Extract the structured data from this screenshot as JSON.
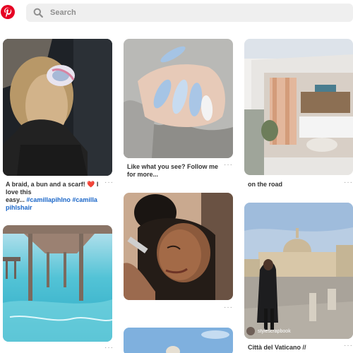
{
  "header": {
    "search_placeholder": "Search",
    "brand_color": "#e60023"
  },
  "pins": [
    {
      "id": "braid",
      "caption_lines": [
        "A braid, a bun and a scarf! ❤️ I",
        "love this"
      ],
      "caption_prefix": "easy...",
      "tags_line1": "#camillapihlno #camilla",
      "tags_line2": "pihlshair",
      "more": "···"
    },
    {
      "id": "nails",
      "caption_lines": [
        "Like what you see? Follow me",
        "for more..."
      ],
      "more": "···"
    },
    {
      "id": "van",
      "caption_lines": [
        "on the road"
      ],
      "more": "···"
    },
    {
      "id": "pier",
      "more": "···"
    },
    {
      "id": "girl",
      "more": "···"
    },
    {
      "id": "vatican",
      "credit": "stylescrapbook",
      "caption_lines": [
        "Città del Vaticano //"
      ],
      "more": "···"
    },
    {
      "id": "sky"
    }
  ]
}
